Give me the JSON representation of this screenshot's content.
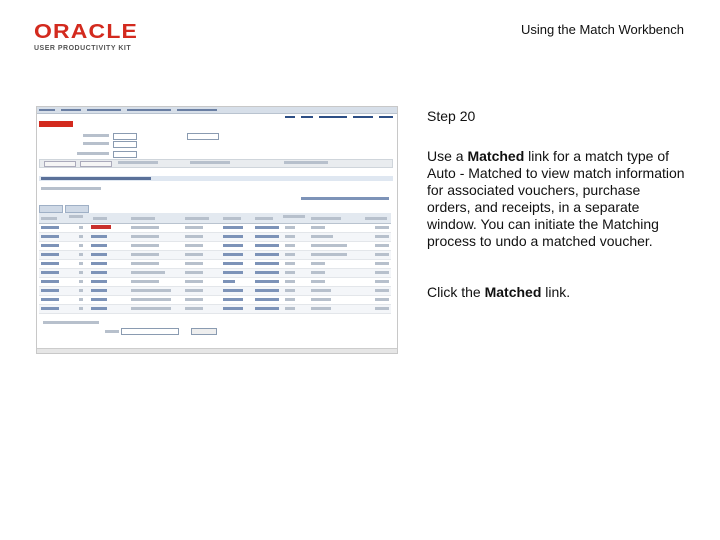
{
  "brand": {
    "name": "ORACLE",
    "subtitle": "USER PRODUCTIVITY KIT"
  },
  "header": {
    "title": "Using the Match Workbench"
  },
  "step": {
    "label": "Step 20"
  },
  "description": {
    "prefix": "Use a ",
    "bold": "Matched",
    "suffix": " link for a match type of Auto - Matched to view match information for associated vouchers, purchase orders, and receipts, in a separate window. You can initiate the Matching process to undo a matched voucher."
  },
  "instruction": {
    "prefix": "Click the ",
    "bold": "Matched",
    "suffix": " link."
  },
  "colors": {
    "oracle_red": "#d32a1e",
    "link_blue": "#7d93b8"
  }
}
